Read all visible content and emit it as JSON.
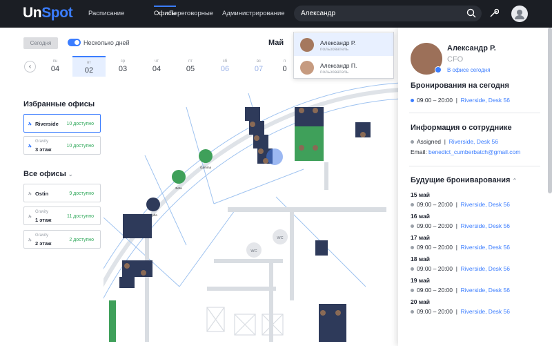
{
  "header": {
    "logo_main": "Un",
    "logo_accent": "Spot",
    "nav": [
      "Расписание",
      "Офисы",
      "Переговорные",
      "Администрирование"
    ],
    "search_value": "Александр"
  },
  "toolbar": {
    "today": "Сегодня",
    "multi_days": "Несколько дней",
    "month": "Май",
    "prev": "‹"
  },
  "days": [
    {
      "w": "пн",
      "n": "04"
    },
    {
      "w": "вт",
      "n": "02"
    },
    {
      "w": "ср",
      "n": "03"
    },
    {
      "w": "чт",
      "n": "04"
    },
    {
      "w": "пт",
      "n": "05"
    },
    {
      "w": "сб",
      "n": "06"
    },
    {
      "w": "вс",
      "n": "07"
    },
    {
      "w": "п",
      "n": "0"
    }
  ],
  "favorites": {
    "title": "Избранные офисы",
    "items": [
      {
        "name": "Riverside",
        "avail": "10 доступно"
      },
      {
        "sub": "Gravity",
        "name": "3 этаж",
        "avail": "10 доступно"
      }
    ]
  },
  "all_offices": {
    "title": "Все офисы",
    "items": [
      {
        "name": "Ostin",
        "avail": "9 доступно"
      },
      {
        "sub": "Gravity",
        "name": "1 этаж",
        "avail": "11 доступно"
      },
      {
        "sub": "Gravity",
        "name": "2 этаж",
        "avail": "2 доступно"
      }
    ]
  },
  "dropdown": [
    {
      "name": "Александр Р.",
      "role": "пользователь"
    },
    {
      "name": "Александр П.",
      "role": "пользователь"
    }
  ],
  "map": {
    "rooms": [
      "Gamma",
      "Beta",
      "Alpha"
    ],
    "wc": [
      "WC",
      "WC"
    ]
  },
  "profile": {
    "name": "Александр Р.",
    "role": "CFO",
    "status": "В офисе сегодня",
    "today_title": "Бронирования на сегодня",
    "today_time": "09:00 – 20:00",
    "today_place": "Riverside, Desk 56",
    "info_title": "Информация о сотруднике",
    "assigned": "Assigned",
    "assigned_place": "Riverside, Desk 56",
    "email_label": "Email:",
    "email": "benedict_cumberbatch@gmail.com",
    "future_title": "Будущие брониварования",
    "future": [
      {
        "date": "15 май",
        "time": "09:00 – 20:00",
        "place": "Riverside, Desk 56"
      },
      {
        "date": "16 май",
        "time": "09:00 – 20:00",
        "place": "Riverside, Desk 56"
      },
      {
        "date": "17 май",
        "time": "09:00 – 20:00",
        "place": "Riverside, Desk 56"
      },
      {
        "date": "18 май",
        "time": "09:00 – 20:00",
        "place": "Riverside, Desk 56"
      },
      {
        "date": "19 май",
        "time": "09:00 – 20:00",
        "place": "Riverside, Desk 56"
      },
      {
        "date": "20 май",
        "time": "09:00 – 20:00",
        "place": "Riverside, Desk 56"
      }
    ]
  },
  "colors": {
    "accent": "#3b7dff",
    "header": "#1b1e24",
    "green": "#2fa85a",
    "desk": "#2e3a5a"
  }
}
